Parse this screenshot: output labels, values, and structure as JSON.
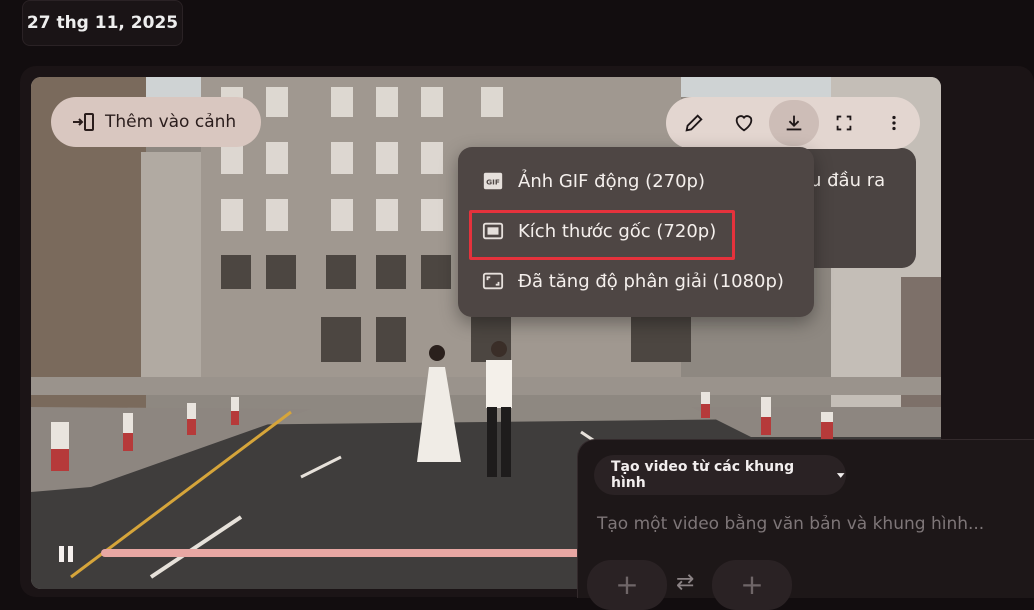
{
  "header": {
    "date": "27 thg 11, 2025"
  },
  "video": {
    "scene_button_label": "Thêm vào cảnh",
    "progress_fraction": 0.53
  },
  "toolbar": {
    "icons": [
      "pencil-icon",
      "heart-icon",
      "download-icon",
      "fullscreen-icon",
      "more-vert-icon"
    ]
  },
  "behind_panel": {
    "text": "u đầu ra"
  },
  "download_menu": {
    "items": [
      {
        "icon": "gif-icon",
        "label": "Ảnh GIF động (270p)"
      },
      {
        "icon": "frame-icon",
        "label": "Kích thước gốc (720p)"
      },
      {
        "icon": "upscale-icon",
        "label": "Đã tăng độ phân giải (1080p)"
      }
    ]
  },
  "prompt": {
    "mode_label": "Tạo video từ các khung hình",
    "placeholder": "Tạo một video bằng văn bản và khung hình...",
    "add_label": "+"
  },
  "colors": {
    "highlight": "#e5323c",
    "progress": "#e8a7a3",
    "pill_bg": "#d9c7c0"
  }
}
